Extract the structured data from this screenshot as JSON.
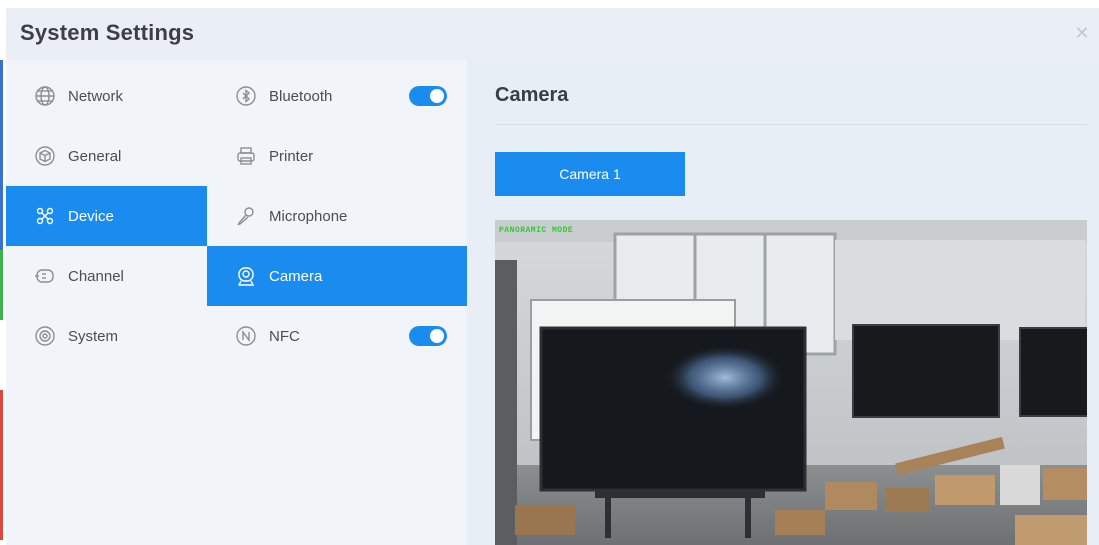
{
  "window": {
    "title": "System Settings",
    "close_glyph": "✕"
  },
  "categories": [
    {
      "label": "Network",
      "icon": "globe-icon",
      "active": false
    },
    {
      "label": "General",
      "icon": "cube-icon",
      "active": false
    },
    {
      "label": "Device",
      "icon": "device-icon",
      "active": true
    },
    {
      "label": "Channel",
      "icon": "channel-icon",
      "active": false
    },
    {
      "label": "System",
      "icon": "system-gear-icon",
      "active": false
    }
  ],
  "devices": [
    {
      "label": "Bluetooth",
      "icon": "bluetooth-icon",
      "toggle": true,
      "active": false
    },
    {
      "label": "Printer",
      "icon": "printer-icon",
      "toggle": null,
      "active": false
    },
    {
      "label": "Microphone",
      "icon": "microphone-icon",
      "toggle": null,
      "active": false
    },
    {
      "label": "Camera",
      "icon": "camera-icon",
      "toggle": null,
      "active": true
    },
    {
      "label": "NFC",
      "icon": "nfc-icon",
      "toggle": true,
      "active": false
    }
  ],
  "main": {
    "title": "Camera",
    "camera_tab": "Camera 1",
    "preview_overlay": "PANORAMIC MODE"
  },
  "colors": {
    "accent": "#1a8cf0",
    "panel": "#f1f5f9",
    "main": "#e7eef5"
  }
}
